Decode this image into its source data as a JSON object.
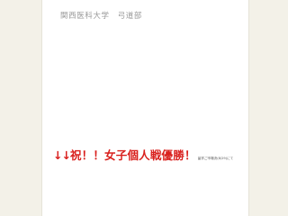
{
  "site": {
    "title": "関西医科大学　弓道部"
  },
  "post": {
    "arrows": "↓↓",
    "headline": "祝！！女子個人戦優勝！",
    "note": "留学ご市場決(8/29)にて"
  },
  "colors": {
    "background": "#f3f1e8",
    "page": "#ffffff",
    "headline": "#d9201d",
    "title": "#9a9a9a"
  }
}
